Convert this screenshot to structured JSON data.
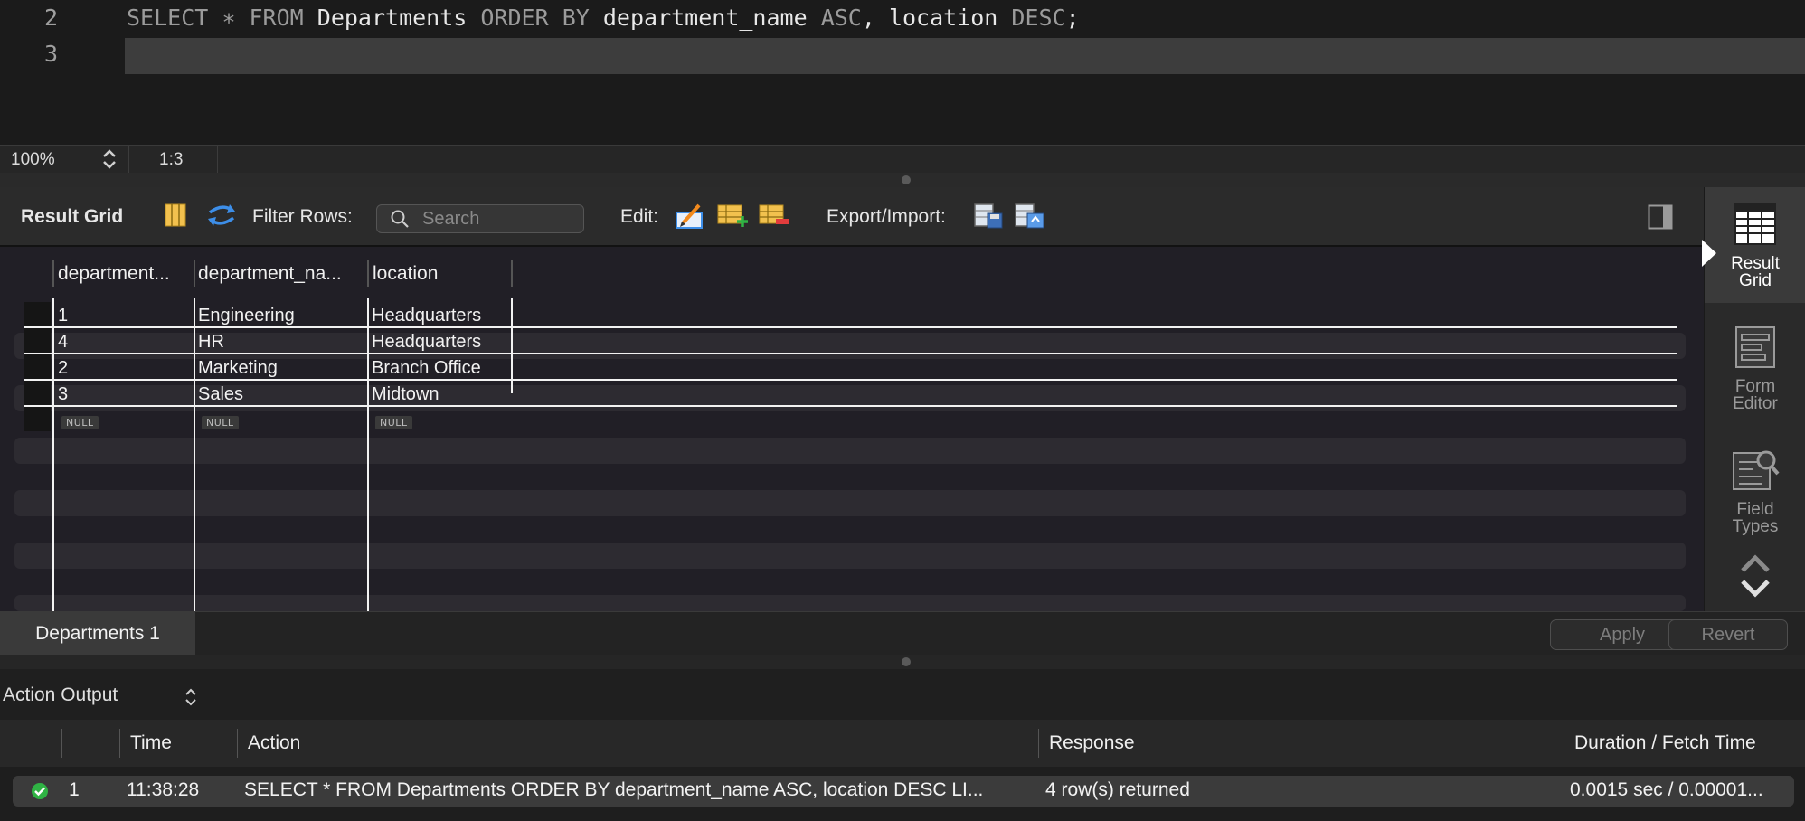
{
  "editor": {
    "lines": [
      {
        "num": "2",
        "tokens": [
          {
            "t": "SELECT",
            "k": true
          },
          {
            "t": " ",
            "k": false
          },
          {
            "t": "∗",
            "k": true
          },
          {
            "t": " ",
            "k": false
          },
          {
            "t": "FROM",
            "k": true
          },
          {
            "t": " Departments ",
            "k": false
          },
          {
            "t": "ORDER BY",
            "k": true
          },
          {
            "t": " department_name ",
            "k": false
          },
          {
            "t": "ASC",
            "k": true
          },
          {
            "t": ", location ",
            "k": false
          },
          {
            "t": "DESC",
            "k": true
          },
          {
            "t": ";",
            "k": false
          }
        ]
      },
      {
        "num": "3",
        "tokens": []
      }
    ]
  },
  "statusbar": {
    "zoom": "100%",
    "position": "1:3"
  },
  "toolbar": {
    "result_grid_label": "Result Grid",
    "filter_rows_label": "Filter Rows:",
    "search_placeholder": "Search",
    "edit_label": "Edit:",
    "export_import_label": "Export/Import:"
  },
  "grid": {
    "columns": [
      "department...",
      "department_na...",
      "location"
    ],
    "rows": [
      [
        "1",
        "Engineering",
        "Headquarters"
      ],
      [
        "4",
        "HR",
        "Headquarters"
      ],
      [
        "2",
        "Marketing",
        "Branch Office"
      ],
      [
        "3",
        "Sales",
        "Midtown"
      ]
    ],
    "null_label": "NULL"
  },
  "right_panel": {
    "result_grid": [
      "Result",
      "Grid"
    ],
    "form_editor": [
      "Form",
      "Editor"
    ],
    "field_types": [
      "Field",
      "Types"
    ]
  },
  "tabs": {
    "active": "Departments 1",
    "apply_label": "Apply",
    "revert_label": "Revert"
  },
  "action_output": {
    "title": "Action Output",
    "columns": {
      "time": "Time",
      "action": "Action",
      "response": "Response",
      "duration": "Duration / Fetch Time"
    },
    "rows": [
      {
        "index": "1",
        "time": "11:38:28",
        "action": "SELECT * FROM Departments ORDER BY department_name ASC, location DESC LI...",
        "response": "4 row(s) returned",
        "duration": "0.0015 sec / 0.00001..."
      }
    ]
  },
  "colors": {
    "success": "#2fb344",
    "accent_blue": "#3d8ee8"
  }
}
